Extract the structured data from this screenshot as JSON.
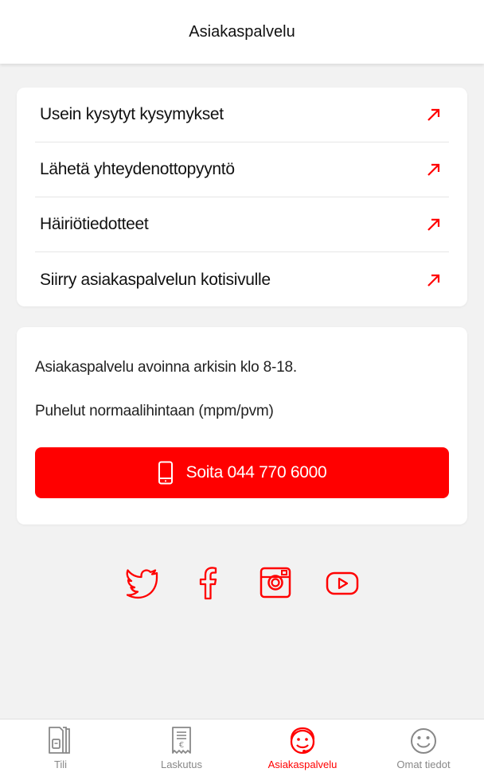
{
  "header": {
    "title": "Asiakaspalvelu"
  },
  "links": [
    {
      "label": "Usein kysytyt kysymykset"
    },
    {
      "label": "Lähetä yhteydenottopyyntö"
    },
    {
      "label": "Häiriötiedotteet"
    },
    {
      "label": "Siirry asiakaspalvelun kotisivulle"
    }
  ],
  "info": {
    "hours": "Asiakaspalvelu avoinna arkisin klo 8-18.",
    "price": "Puhelut normaalihintaan (mpm/pvm)",
    "call_label": "Soita 044 770 6000"
  },
  "social": [
    "twitter-icon",
    "facebook-icon",
    "instagram-icon",
    "youtube-icon"
  ],
  "nav": {
    "items": [
      {
        "label": "Tili",
        "icon": "sim-icon"
      },
      {
        "label": "Laskutus",
        "icon": "invoice-icon"
      },
      {
        "label": "Asiakaspalvelu",
        "icon": "support-icon",
        "active": true
      },
      {
        "label": "Omat tiedot",
        "icon": "smiley-icon"
      }
    ]
  },
  "colors": {
    "accent": "#ff0000",
    "background": "#f2f2f2"
  }
}
